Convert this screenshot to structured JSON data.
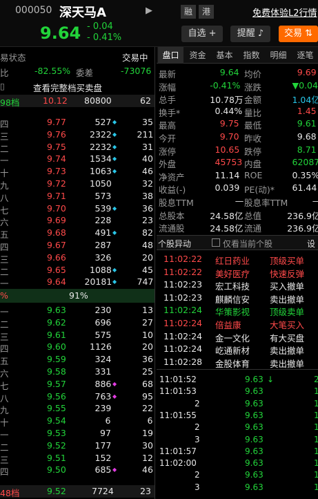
{
  "header": {
    "code": "000050",
    "name": "深天马A",
    "tag1": "融",
    "tag2": "港",
    "trial_link": "免费体验L2行情",
    "price": "9.64",
    "change": "- 0.04",
    "change_pct": "- 0.41%",
    "watch_btn": "自选",
    "alert_btn": "提醒",
    "trade_btn": "交易"
  },
  "left": {
    "status_label": "易状态",
    "status_value": "交易中",
    "ratio_label": "比",
    "ratio_value": "-82.55%",
    "diff_label": "委差",
    "diff_value": "-73076",
    "full_book": "查看完整档买卖盘",
    "ask_top": {
      "label": "98档",
      "price": "10.12",
      "vol": "80800",
      "count": "62"
    },
    "asks": [
      {
        "label": "四",
        "price": "9.77",
        "vol": "527",
        "dot": "cyan",
        "count": "35"
      },
      {
        "label": "三",
        "price": "9.76",
        "vol": "2322",
        "dot": "cyan",
        "count": "211"
      },
      {
        "label": "二",
        "price": "9.75",
        "vol": "2232",
        "dot": "cyan",
        "count": "31"
      },
      {
        "label": "一",
        "price": "9.74",
        "vol": "1534",
        "dot": "cyan",
        "count": "40"
      },
      {
        "label": "十",
        "price": "9.73",
        "vol": "1063",
        "dot": "cyan",
        "count": "46"
      },
      {
        "label": "九",
        "price": "9.72",
        "vol": "1050",
        "dot": "",
        "count": "32"
      },
      {
        "label": "八",
        "price": "9.71",
        "vol": "573",
        "dot": "",
        "count": "38"
      },
      {
        "label": "七",
        "price": "9.70",
        "vol": "539",
        "dot": "cyan",
        "count": "36"
      },
      {
        "label": "六",
        "price": "9.69",
        "vol": "228",
        "dot": "",
        "count": "23"
      },
      {
        "label": "五",
        "price": "9.68",
        "vol": "491",
        "dot": "cyan",
        "count": "82"
      },
      {
        "label": "四",
        "price": "9.67",
        "vol": "287",
        "dot": "",
        "count": "48"
      },
      {
        "label": "三",
        "price": "9.66",
        "vol": "326",
        "dot": "",
        "count": "20"
      },
      {
        "label": "二",
        "price": "9.65",
        "vol": "1088",
        "dot": "cyan",
        "count": "45"
      },
      {
        "label": "一",
        "price": "9.64",
        "vol": "20181",
        "dot": "cyan",
        "count": "747"
      }
    ],
    "mid_left": "%",
    "mid_value": "91%",
    "bids": [
      {
        "label": "一",
        "price": "9.63",
        "vol": "230",
        "dot": "",
        "count": "13"
      },
      {
        "label": "二",
        "price": "9.62",
        "vol": "696",
        "dot": "",
        "count": "27"
      },
      {
        "label": "三",
        "price": "9.61",
        "vol": "575",
        "dot": "",
        "count": "10"
      },
      {
        "label": "四",
        "price": "9.60",
        "vol": "1126",
        "dot": "",
        "count": "20"
      },
      {
        "label": "五",
        "price": "9.59",
        "vol": "324",
        "dot": "",
        "count": "36"
      },
      {
        "label": "六",
        "price": "9.58",
        "vol": "331",
        "dot": "",
        "count": "25"
      },
      {
        "label": "七",
        "price": "9.57",
        "vol": "886",
        "dot": "mag",
        "count": "68"
      },
      {
        "label": "八",
        "price": "9.56",
        "vol": "763",
        "dot": "mag",
        "count": "95"
      },
      {
        "label": "九",
        "price": "9.55",
        "vol": "239",
        "dot": "",
        "count": "22"
      },
      {
        "label": "十",
        "price": "9.54",
        "vol": "6",
        "dot": "",
        "count": "6"
      },
      {
        "label": "一",
        "price": "9.53",
        "vol": "97",
        "dot": "",
        "count": "19"
      },
      {
        "label": "二",
        "price": "9.52",
        "vol": "177",
        "dot": "",
        "count": "30"
      },
      {
        "label": "三",
        "price": "9.51",
        "vol": "152",
        "dot": "",
        "count": "12"
      },
      {
        "label": "四",
        "price": "9.50",
        "vol": "685",
        "dot": "mag",
        "count": "46"
      }
    ],
    "bid_bottom": {
      "label": "48档",
      "price": "9.52",
      "vol": "7724",
      "count": "23"
    }
  },
  "right": {
    "tabs": [
      "盘口",
      "资金",
      "基本",
      "指数",
      "明细",
      "逐笔"
    ],
    "stats": [
      {
        "l1": "最新",
        "v1": "9.64",
        "c1": "green",
        "l2": "均价",
        "v2": "9.69",
        "c2": "red"
      },
      {
        "l1": "涨幅",
        "v1": "-0.41%",
        "c1": "green",
        "l2": "涨跌",
        "v2": "▼0.04",
        "c2": "green"
      },
      {
        "l1": "总手",
        "v1": "10.78万",
        "c1": "white",
        "l2": "金额",
        "v2": "1.04亿",
        "c2": "cyan"
      },
      {
        "l1": "换手*",
        "v1": "0.44%",
        "c1": "white",
        "l2": "量比",
        "v2": "1.45",
        "c2": "red"
      },
      {
        "l1": "最高",
        "v1": "9.75",
        "c1": "red",
        "l2": "最低",
        "v2": "9.61",
        "c2": "green"
      },
      {
        "l1": "今开",
        "v1": "9.70",
        "c1": "red",
        "l2": "昨收",
        "v2": "9.68",
        "c2": "white"
      },
      {
        "l1": "涨停",
        "v1": "10.65",
        "c1": "red",
        "l2": "跌停",
        "v2": "8.71",
        "c2": "green"
      },
      {
        "l1": "外盘",
        "v1": "45753",
        "c1": "red",
        "l2": "内盘",
        "v2": "62087",
        "c2": "green"
      },
      {
        "l1": "净资产",
        "v1": "11.14",
        "c1": "white",
        "l2": "ROE",
        "v2": "0.35%",
        "c2": "white"
      },
      {
        "l1": "收益(-)",
        "v1": "0.039",
        "c1": "white",
        "l2": "PE(动)*",
        "v2": "61.44",
        "c2": "white"
      },
      {
        "l1": "股息TTM",
        "v1": "—",
        "c1": "white",
        "l2": "股息率TTM",
        "v2": "—",
        "c2": "white"
      },
      {
        "l1": "总股本",
        "v1": "24.58亿",
        "c1": "white",
        "l2": "总值",
        "v2": "236.9亿",
        "c2": "white"
      },
      {
        "l1": "流通股",
        "v1": "24.58亿",
        "c1": "white",
        "l2": "流通",
        "v2": "236.9亿",
        "c2": "white"
      }
    ],
    "anomaly_title": "个股异动",
    "anomaly_check": "仅看当前个股",
    "anomaly_settings": "设",
    "anomalies": [
      {
        "time": "11:02:22",
        "name": "红日药业",
        "event": "顶级买单",
        "color": "red"
      },
      {
        "time": "11:02:22",
        "name": "美好医疗",
        "event": "快速反弹",
        "color": "red"
      },
      {
        "time": "11:02:23",
        "name": "宏工科技",
        "event": "买入撤单",
        "color": "white"
      },
      {
        "time": "11:02:23",
        "name": "麒麟信安",
        "event": "卖出撤单",
        "color": "white"
      },
      {
        "time": "11:02:24",
        "name": "华策影视",
        "event": "顶级卖单",
        "color": "green"
      },
      {
        "time": "11:02:24",
        "name": "倍益康",
        "event": "大笔买入",
        "color": "red"
      },
      {
        "time": "11:02:24",
        "name": "金一文化",
        "event": "有大买盘",
        "color": "white"
      },
      {
        "time": "11:02:24",
        "name": "屹通新材",
        "event": "卖出撤单",
        "color": "white"
      },
      {
        "time": "11:02:28",
        "name": "金股体育",
        "event": "卖出撤单",
        "color": "white"
      }
    ],
    "ticks": [
      {
        "time": "11:01:52",
        "price": "9.63",
        "arrow": "↓",
        "vol": "2"
      },
      {
        "time": "11:01:53",
        "price": "9.63",
        "arrow": "",
        "vol": "1"
      },
      {
        "time": "2",
        "price": "9.63",
        "arrow": "",
        "vol": "1"
      },
      {
        "time": "11:01:55",
        "price": "9.63",
        "arrow": "",
        "vol": "1"
      },
      {
        "time": "2",
        "price": "9.63",
        "arrow": "",
        "vol": "1"
      },
      {
        "time": "3",
        "price": "9.63",
        "arrow": "",
        "vol": "1"
      },
      {
        "time": "11:01:57",
        "price": "9.63",
        "arrow": "",
        "vol": "1"
      },
      {
        "time": "11:02:00",
        "price": "9.63",
        "arrow": "",
        "vol": "1"
      },
      {
        "time": "2",
        "price": "9.63",
        "arrow": "",
        "vol": "1"
      },
      {
        "time": "3",
        "price": "9.63",
        "arrow": "",
        "vol": "1"
      }
    ]
  }
}
